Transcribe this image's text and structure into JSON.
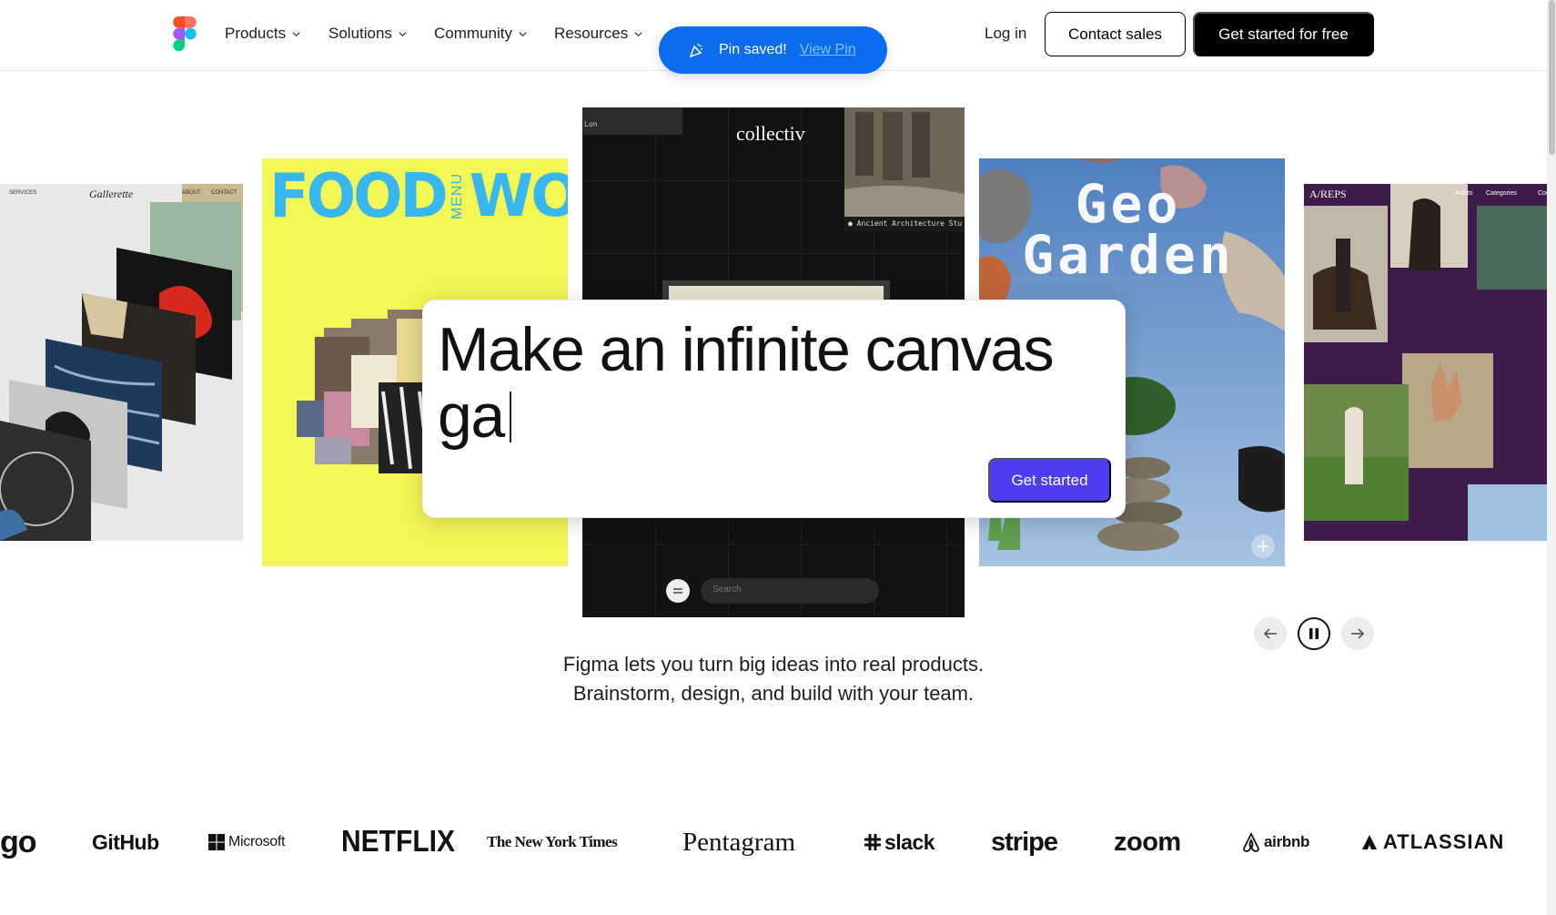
{
  "nav": {
    "items": [
      {
        "label": "Products"
      },
      {
        "label": "Solutions"
      },
      {
        "label": "Community"
      },
      {
        "label": "Resources"
      }
    ],
    "login": "Log in",
    "contact": "Contact sales",
    "cta": "Get started for free"
  },
  "toast": {
    "message": "Pin saved!",
    "link": "View Pin"
  },
  "cards": {
    "a": {
      "title": "Gallerette",
      "nav_left": "SERVICES",
      "nav_right1": "ABOUT",
      "nav_right2": "CONTACT"
    },
    "b": {
      "title_left": "FOOD",
      "title_mid": "MENU",
      "title_right": "WORKS"
    },
    "c": {
      "title": "collectiv",
      "caption": "Ancient Architecture Stu",
      "search_placeholder": "Search",
      "tag": "Lon"
    },
    "d": {
      "title_line1": "Geo",
      "title_line2": "Garden"
    },
    "e": {
      "title": "A/REPS",
      "link1": "Artists",
      "link2": "Categories",
      "link3": "Con"
    }
  },
  "prompt": {
    "line1": "Make an infinite canvas",
    "line2": "ga",
    "button": "Get started"
  },
  "tagline": {
    "line1": "Figma lets you turn big ideas into real products.",
    "line2": "Brainstorm, design, and build with your team."
  },
  "logos": {
    "duolingo_partial": "go",
    "github": "GitHub",
    "microsoft": "Microsoft",
    "netflix": "NETFLIX",
    "nyt": "The New York Times",
    "pentagram": "Pentagram",
    "slack": "slack",
    "stripe": "stripe",
    "zoom": "zoom",
    "airbnb": "airbnb",
    "atlassian": "ATLASSIAN"
  },
  "colors": {
    "toast": "#0b6cf0",
    "prompt_button": "#4c3ef0",
    "food_bg": "#f2f756",
    "food_text": "#38b6f0",
    "areps_bg": "#3d1b4a"
  }
}
